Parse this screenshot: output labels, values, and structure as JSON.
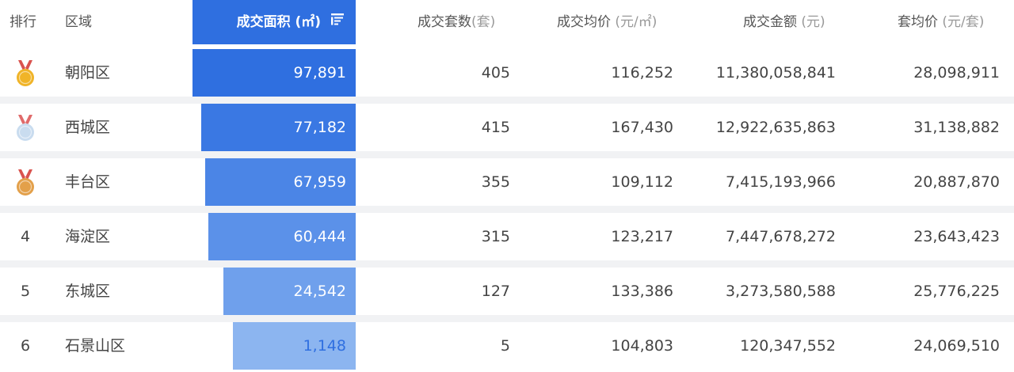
{
  "header": {
    "rank": "排行",
    "region": "区域",
    "area": "成交面积",
    "area_unit": "(㎡)",
    "count": "成交套数",
    "count_unit": "(套)",
    "avg_price": "成交均价",
    "avg_price_unit": "(元/㎡)",
    "amount": "成交金额",
    "amount_unit": "(元)",
    "unit_price": "套均价",
    "unit_price_unit": "(元/套)"
  },
  "colors": {
    "header_accent": "#2f6fe0",
    "gold_medal": "#f0b428",
    "silver_medal": "#c9dcef",
    "bronze_medal": "#e3a04a",
    "ribbon": "#d9534f"
  },
  "rows": [
    {
      "rank": "1",
      "medal": "gold-medal-icon",
      "region": "朝阳区",
      "area": "97,891",
      "area_value": 97891,
      "count": "405",
      "avg_price": "116,252",
      "amount": "11,380,058,841",
      "unit_price": "28,098,911",
      "bar_color": "#2f6fe0"
    },
    {
      "rank": "2",
      "medal": "silver-medal-icon",
      "region": "西城区",
      "area": "77,182",
      "area_value": 77182,
      "count": "415",
      "avg_price": "167,430",
      "amount": "12,922,635,863",
      "unit_price": "31,138,882",
      "bar_color": "#3a78e3"
    },
    {
      "rank": "3",
      "medal": "bronze-medal-icon",
      "region": "丰台区",
      "area": "67,959",
      "area_value": 67959,
      "count": "355",
      "avg_price": "109,112",
      "amount": "7,415,193,966",
      "unit_price": "20,887,870",
      "bar_color": "#4b85e6"
    },
    {
      "rank": "4",
      "medal": "",
      "region": "海淀区",
      "area": "60,444",
      "area_value": 60444,
      "count": "315",
      "avg_price": "123,217",
      "amount": "7,447,678,272",
      "unit_price": "23,643,423",
      "bar_color": "#5b91e9"
    },
    {
      "rank": "5",
      "medal": "",
      "region": "东城区",
      "area": "24,542",
      "area_value": 24542,
      "count": "127",
      "avg_price": "133,386",
      "amount": "3,273,580,588",
      "unit_price": "25,776,225",
      "bar_color": "#6fa0ec"
    },
    {
      "rank": "6",
      "medal": "",
      "region": "石景山区",
      "area": "1,148",
      "area_value": 1148,
      "count": "5",
      "avg_price": "104,803",
      "amount": "120,347,552",
      "unit_price": "24,069,510",
      "bar_color": "#8cb5f0",
      "bar_text_color": "#2f6fe0"
    }
  ]
}
